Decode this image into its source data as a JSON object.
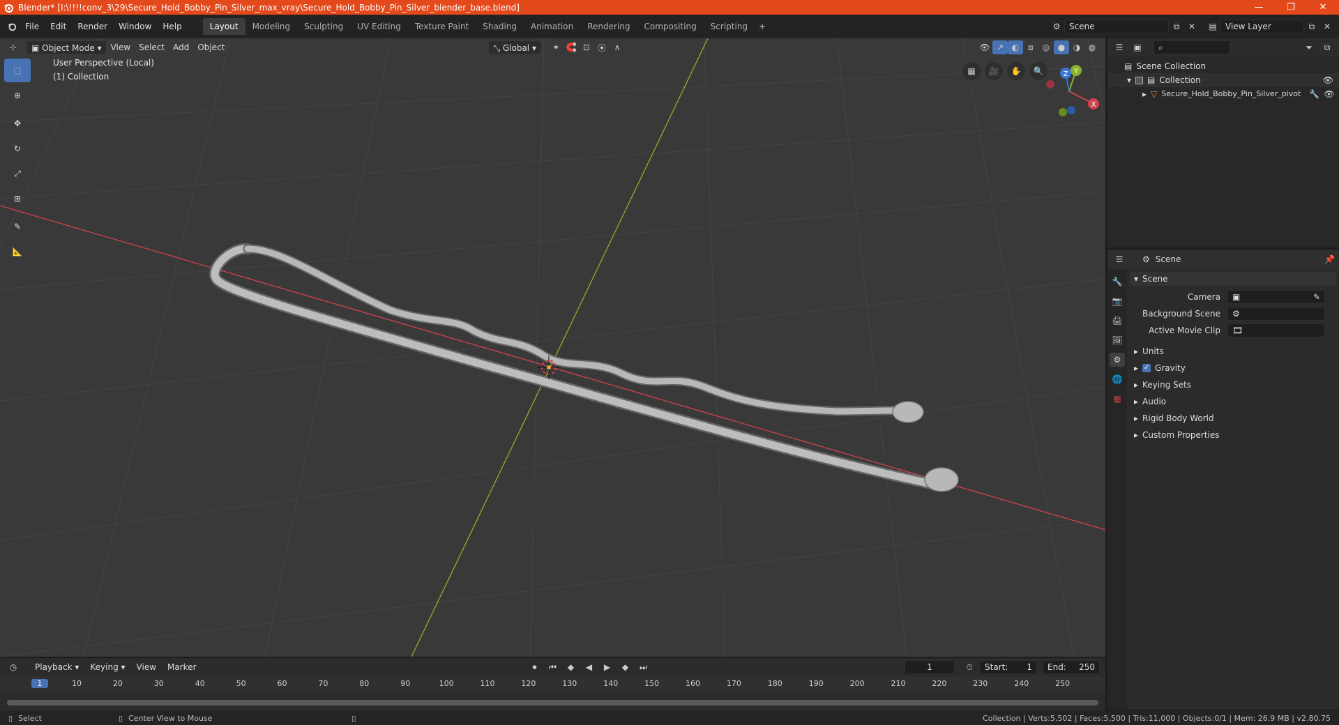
{
  "window": {
    "title": "Blender* [I:\\!!!!conv_3\\29\\Secure_Hold_Bobby_Pin_Silver_max_vray\\Secure_Hold_Bobby_Pin_Silver_blender_base.blend]",
    "minimize": "—",
    "maximize": "❐",
    "close": "✕"
  },
  "menu": [
    "File",
    "Edit",
    "Render",
    "Window",
    "Help"
  ],
  "workspaces": [
    "Layout",
    "Modeling",
    "Sculpting",
    "UV Editing",
    "Texture Paint",
    "Shading",
    "Animation",
    "Rendering",
    "Compositing",
    "Scripting"
  ],
  "active_workspace": "Layout",
  "scene_field": "Scene",
  "view_layer_field": "View Layer",
  "viewport_header": {
    "mode": "Object Mode",
    "menus": [
      "View",
      "Select",
      "Add",
      "Object"
    ],
    "orientation": "Global"
  },
  "viewport_overlay": {
    "line1": "User Perspective (Local)",
    "line2": "(1) Collection"
  },
  "gizmo_axes": {
    "x": "X",
    "y": "Y",
    "z": "Z"
  },
  "outliner": {
    "root": "Scene Collection",
    "collection": "Collection",
    "object": "Secure_Hold_Bobby_Pin_Silver_pivot"
  },
  "properties": {
    "header": "Scene",
    "panel": "Scene",
    "fields": [
      {
        "label": "Camera",
        "value": ""
      },
      {
        "label": "Background Scene",
        "value": ""
      },
      {
        "label": "Active Movie Clip",
        "value": ""
      }
    ],
    "sections": [
      "Units",
      "Gravity",
      "Keying Sets",
      "Audio",
      "Rigid Body World",
      "Custom Properties"
    ],
    "gravity_checked": true
  },
  "timeline": {
    "menus": [
      "Playback",
      "Keying",
      "View",
      "Marker"
    ],
    "current_frame": "1",
    "start_label": "Start:",
    "start": "1",
    "end_label": "End:",
    "end": "250",
    "ruler": [
      "1",
      "10",
      "20",
      "30",
      "40",
      "50",
      "60",
      "70",
      "80",
      "90",
      "100",
      "110",
      "120",
      "130",
      "140",
      "150",
      "160",
      "170",
      "180",
      "190",
      "200",
      "210",
      "220",
      "230",
      "240",
      "250"
    ]
  },
  "status": {
    "left1": "Select",
    "left2": "Center View to Mouse",
    "right": "Collection | Verts:5,502 | Faces:5,500 | Tris:11,000 | Objects:0/1 | Mem: 26.9 MB | v2.80.75"
  },
  "colors": {
    "titlebar": "#e4491c",
    "accent": "#4772b3",
    "axis_x": "#d1434f",
    "axis_y": "#8ab22a"
  }
}
